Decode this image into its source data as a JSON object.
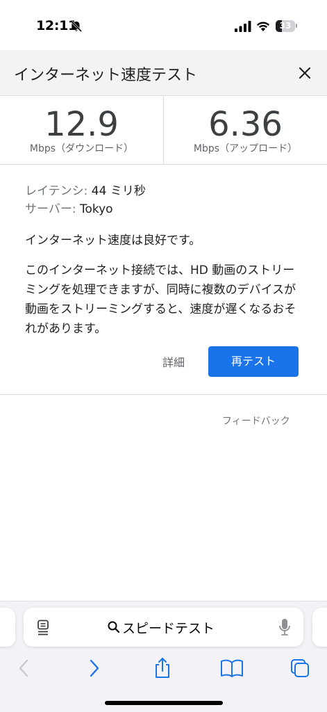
{
  "status_bar": {
    "time": "12:11",
    "battery_level": "33",
    "battery_fraction": 0.33
  },
  "header": {
    "title": "インターネット速度テスト"
  },
  "results": {
    "download_value": "12.9",
    "download_unit": "Mbps（ダウンロード）",
    "upload_value": "6.36",
    "upload_unit": "Mbps（アップロード）"
  },
  "details": {
    "latency_label": "レイテンシ:",
    "latency_value": "44 ミリ秒",
    "server_label": "サーバー:",
    "server_value": "Tokyo",
    "summary": "インターネット速度は良好です。",
    "description": "このインターネット接続では、HD 動画のストリーミングを処理できますが、同時に複数のデバイスが動画をストリーミングすると、速度が遅くなるおそれがあります。",
    "details_link": "詳細",
    "retest_button": "再テスト",
    "feedback": "フィードバック"
  },
  "browser": {
    "search_query": "スピードテスト",
    "accent": "#1a73e8"
  },
  "icons": [
    "bell-slash-icon",
    "signal-icon",
    "wifi-icon",
    "close-icon",
    "reader-icon",
    "search-icon",
    "mic-icon",
    "back-icon",
    "forward-icon",
    "share-icon",
    "bookmarks-icon",
    "tabs-icon"
  ]
}
